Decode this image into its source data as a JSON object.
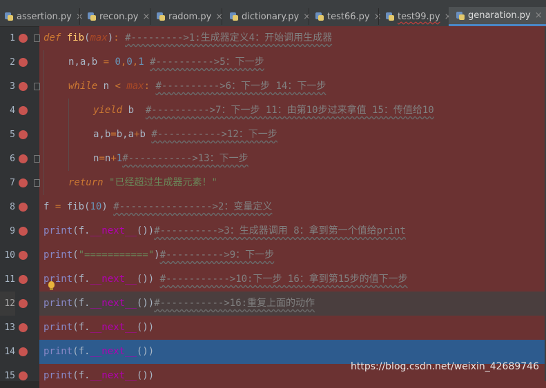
{
  "tabs": [
    {
      "label": "assertion.py",
      "active": false
    },
    {
      "label": "recon.py",
      "active": false
    },
    {
      "label": "radom.py",
      "active": false
    },
    {
      "label": "dictionary.py",
      "active": false
    },
    {
      "label": "test66.py",
      "active": false
    },
    {
      "label": "test99.py",
      "active": false
    },
    {
      "label": "genaration.py",
      "active": true
    }
  ],
  "close_glyph": "×",
  "lines": [
    {
      "n": "1"
    },
    {
      "n": "2"
    },
    {
      "n": "3"
    },
    {
      "n": "4"
    },
    {
      "n": "5"
    },
    {
      "n": "6"
    },
    {
      "n": "7"
    },
    {
      "n": "8"
    },
    {
      "n": "9"
    },
    {
      "n": "10"
    },
    {
      "n": "11"
    },
    {
      "n": "12"
    },
    {
      "n": "13"
    },
    {
      "n": "14"
    },
    {
      "n": "15"
    }
  ],
  "code": {
    "l1": {
      "def": "def",
      "name": "fib",
      "p1": "(",
      "param": "max",
      "p2": ")",
      "colon": ":",
      "comment": "#--------->1:生成器定义4：开始调用生成器"
    },
    "l2": {
      "text": "n,a,b",
      "eq": " = ",
      "v1": "0",
      "c1": ",",
      "v2": "0",
      "c2": ",",
      "v3": "1",
      "comment": "#---------->5：下一步"
    },
    "l3": {
      "kw": "while",
      "a": " n ",
      "lt": "<",
      "param": " max",
      "colon": ":",
      "comment": "#---------->6：下一步 14：下一步"
    },
    "l4": {
      "kw": "yield",
      "a": " b  ",
      "comment": "#---------->7：下一步 11：由第10步过来拿值 15：传值给10"
    },
    "l5": {
      "a": "a,b",
      "eq": "=",
      "b": "b,a",
      "plus": "+",
      "c": "b ",
      "comment": "#----------->12：下一步"
    },
    "l6": {
      "a": "n",
      "eq": "=",
      "b": "n",
      "plus": "+",
      "num": "1",
      "comment": "#----------->13：下一步"
    },
    "l7": {
      "kw": "return",
      "str": "\"已经超过生成器元素！\""
    },
    "l8": {
      "a": "f",
      "eq": " = ",
      "fn": "fib",
      "p1": "(",
      "num": "10",
      "p2": ")",
      "comment": "#---------------->2：变量定义"
    },
    "l9": {
      "print": "print",
      "a": "(f.",
      "dunder": "__next__",
      "b": "())",
      "comment": "#---------->3：生成器调用 8：拿到第一个值给print"
    },
    "l10": {
      "print": "print",
      "p1": "(",
      "str": "\"===========\"",
      "p2": ")",
      "comment": "#---------->9：下一步"
    },
    "l11": {
      "print": "print",
      "a": "(f.",
      "dunder": "__next__",
      "b": "())",
      "comment": "#----------->10:下一步 16：拿到第15步的值下一步"
    },
    "l12": {
      "print": "print",
      "a": "(f.",
      "dunder": "__next__",
      "b": "())",
      "comment": "#----------->16:重复上面的动作"
    },
    "l13": {
      "print": "print",
      "a": "(f.",
      "dunder": "__next__",
      "b": "())"
    },
    "l14": {
      "print": "print",
      "a": "(f.",
      "dunder": "__next__",
      "b": "())"
    },
    "l15": {
      "print": "print",
      "a": "(f.",
      "dunder": "__next__",
      "b": "())"
    }
  },
  "watermark": "https://blog.csdn.net/weixin_42689746",
  "colors": {
    "breakpoint_line": "#6b3232",
    "selected_line": "#2d5b8e",
    "breakpoint": "#c75450",
    "keyword": "#cc7832",
    "function": "#ffc66d",
    "number": "#6897bb",
    "string": "#6a8759",
    "comment": "#808080",
    "builtin": "#8888c6",
    "dunder": "#b200b2"
  },
  "icons": {
    "tab_icon": "python-file-icon",
    "breakpoint": "breakpoint-icon",
    "fold": "fold-marker-icon",
    "intention": "lightbulb-icon"
  }
}
